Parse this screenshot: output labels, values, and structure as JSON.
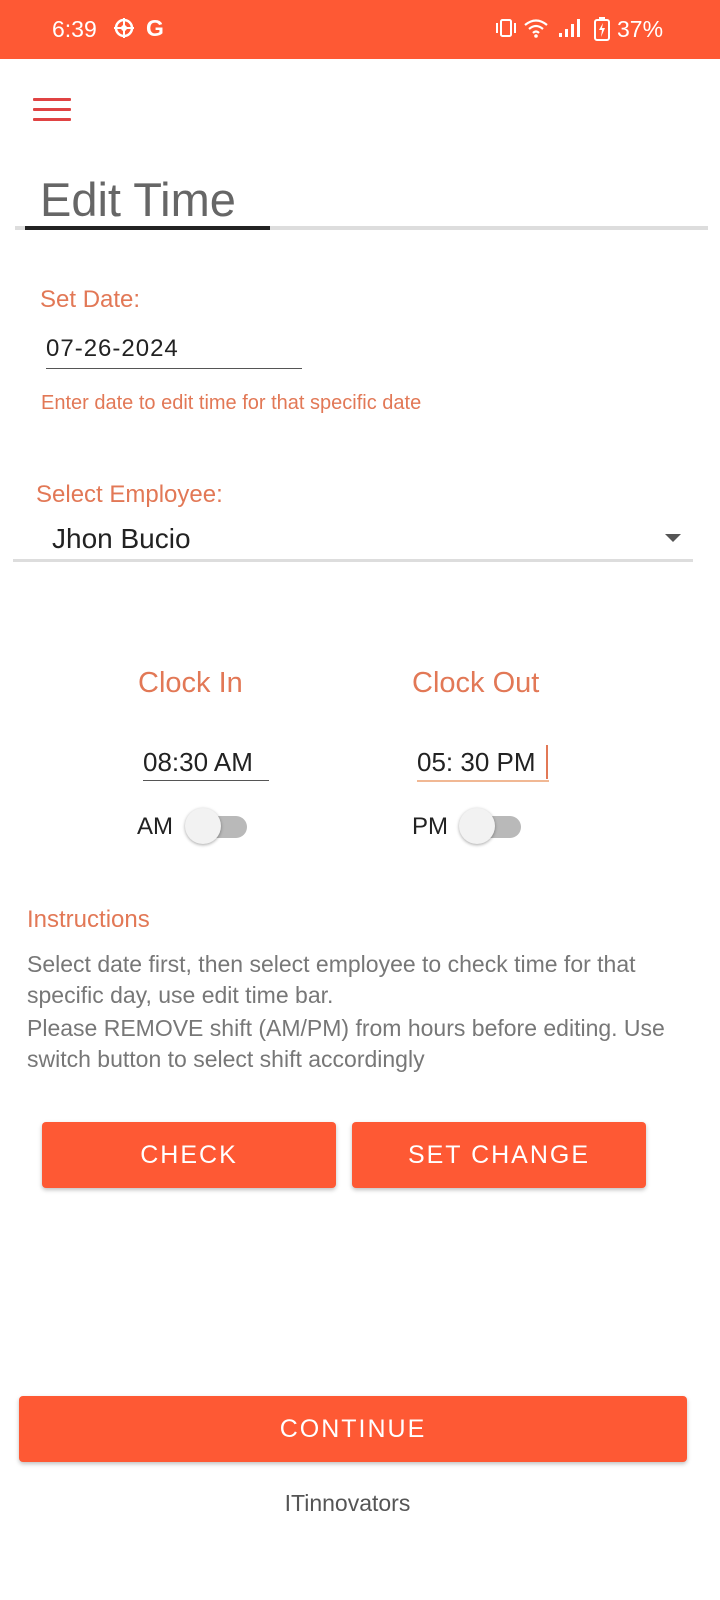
{
  "status_bar": {
    "time": "6:39",
    "g_label": "G",
    "battery_percent": "37%",
    "icons": [
      "settings-gear-icon",
      "vibrate-icon",
      "wifi-icon",
      "signal-icon",
      "battery-icon"
    ]
  },
  "header": {
    "menu_icon": "hamburger-menu-icon",
    "title": "Edit Time"
  },
  "date_section": {
    "label": "Set Date:",
    "value": "07-26-2024",
    "hint": "Enter date to edit time for that specific date"
  },
  "employee_section": {
    "label": "Select Employee:",
    "selected": "Jhon Bucio"
  },
  "clock_in": {
    "heading": "Clock In",
    "value": "08:30 AM",
    "switch_label": "AM",
    "switch_on": false
  },
  "clock_out": {
    "heading": "Clock Out",
    "value": "05: 30 PM",
    "switch_label": "PM",
    "switch_on": false
  },
  "instructions": {
    "heading": "Instructions",
    "line1": "Select date first, then select employee to check time for that specific day, use edit time bar.",
    "line2": "Please REMOVE shift (AM/PM) from hours before editing. Use switch button to select shift accordingly"
  },
  "buttons": {
    "check": "CHECK",
    "set_change": "SET CHANGE",
    "continue": "CONTINUE"
  },
  "footer": {
    "brand": "ITinnovators"
  },
  "colors": {
    "accent": "#fe5934",
    "label_orange": "#e27856",
    "menu_red": "#e04343"
  }
}
